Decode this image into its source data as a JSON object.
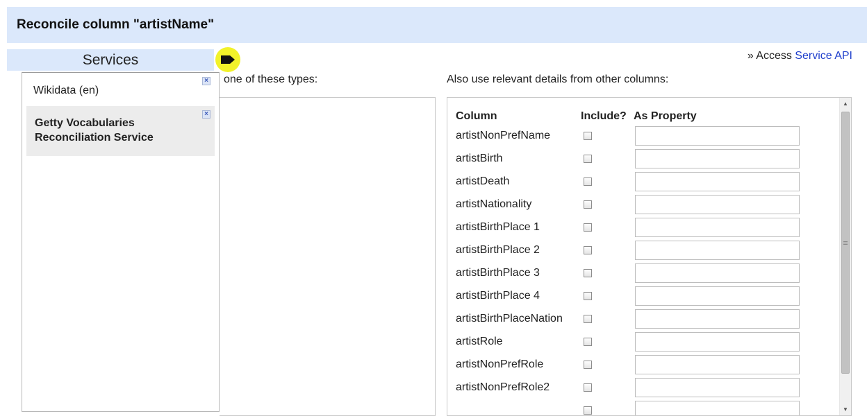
{
  "dialog": {
    "title": "Reconcile column \"artistName\""
  },
  "services": {
    "header": "Services",
    "items": [
      {
        "label": "Wikidata (en)",
        "selected": false
      },
      {
        "label": "Getty Vocabularies Reconciliation Service",
        "selected": true
      }
    ],
    "remove_glyph": "×"
  },
  "access": {
    "prefix": "» Access ",
    "link": "Service API"
  },
  "types": {
    "label": "one of these types:"
  },
  "details": {
    "label": "Also use relevant details from other columns:",
    "headers": {
      "column": "Column",
      "include": "Include?",
      "property": "As Property"
    },
    "rows": [
      {
        "name": "artistNonPrefName"
      },
      {
        "name": "artistBirth"
      },
      {
        "name": "artistDeath"
      },
      {
        "name": "artistNationality"
      },
      {
        "name": "artistBirthPlace 1"
      },
      {
        "name": "artistBirthPlace 2"
      },
      {
        "name": "artistBirthPlace 3"
      },
      {
        "name": "artistBirthPlace 4"
      },
      {
        "name": "artistBirthPlaceNation"
      },
      {
        "name": "artistRole"
      },
      {
        "name": "artistNonPrefRole"
      },
      {
        "name": "artistNonPrefRole2"
      },
      {
        "name": ""
      }
    ]
  },
  "icons": {
    "tag": "tag-icon",
    "remove": "close-icon",
    "scroll_up": "arrow-up-icon",
    "scroll_down": "arrow-down-icon"
  },
  "colors": {
    "header_bg": "#dbe8fb",
    "highlight": "#f2f22a",
    "link": "#1f3fcc",
    "selected_bg": "#ececec"
  }
}
